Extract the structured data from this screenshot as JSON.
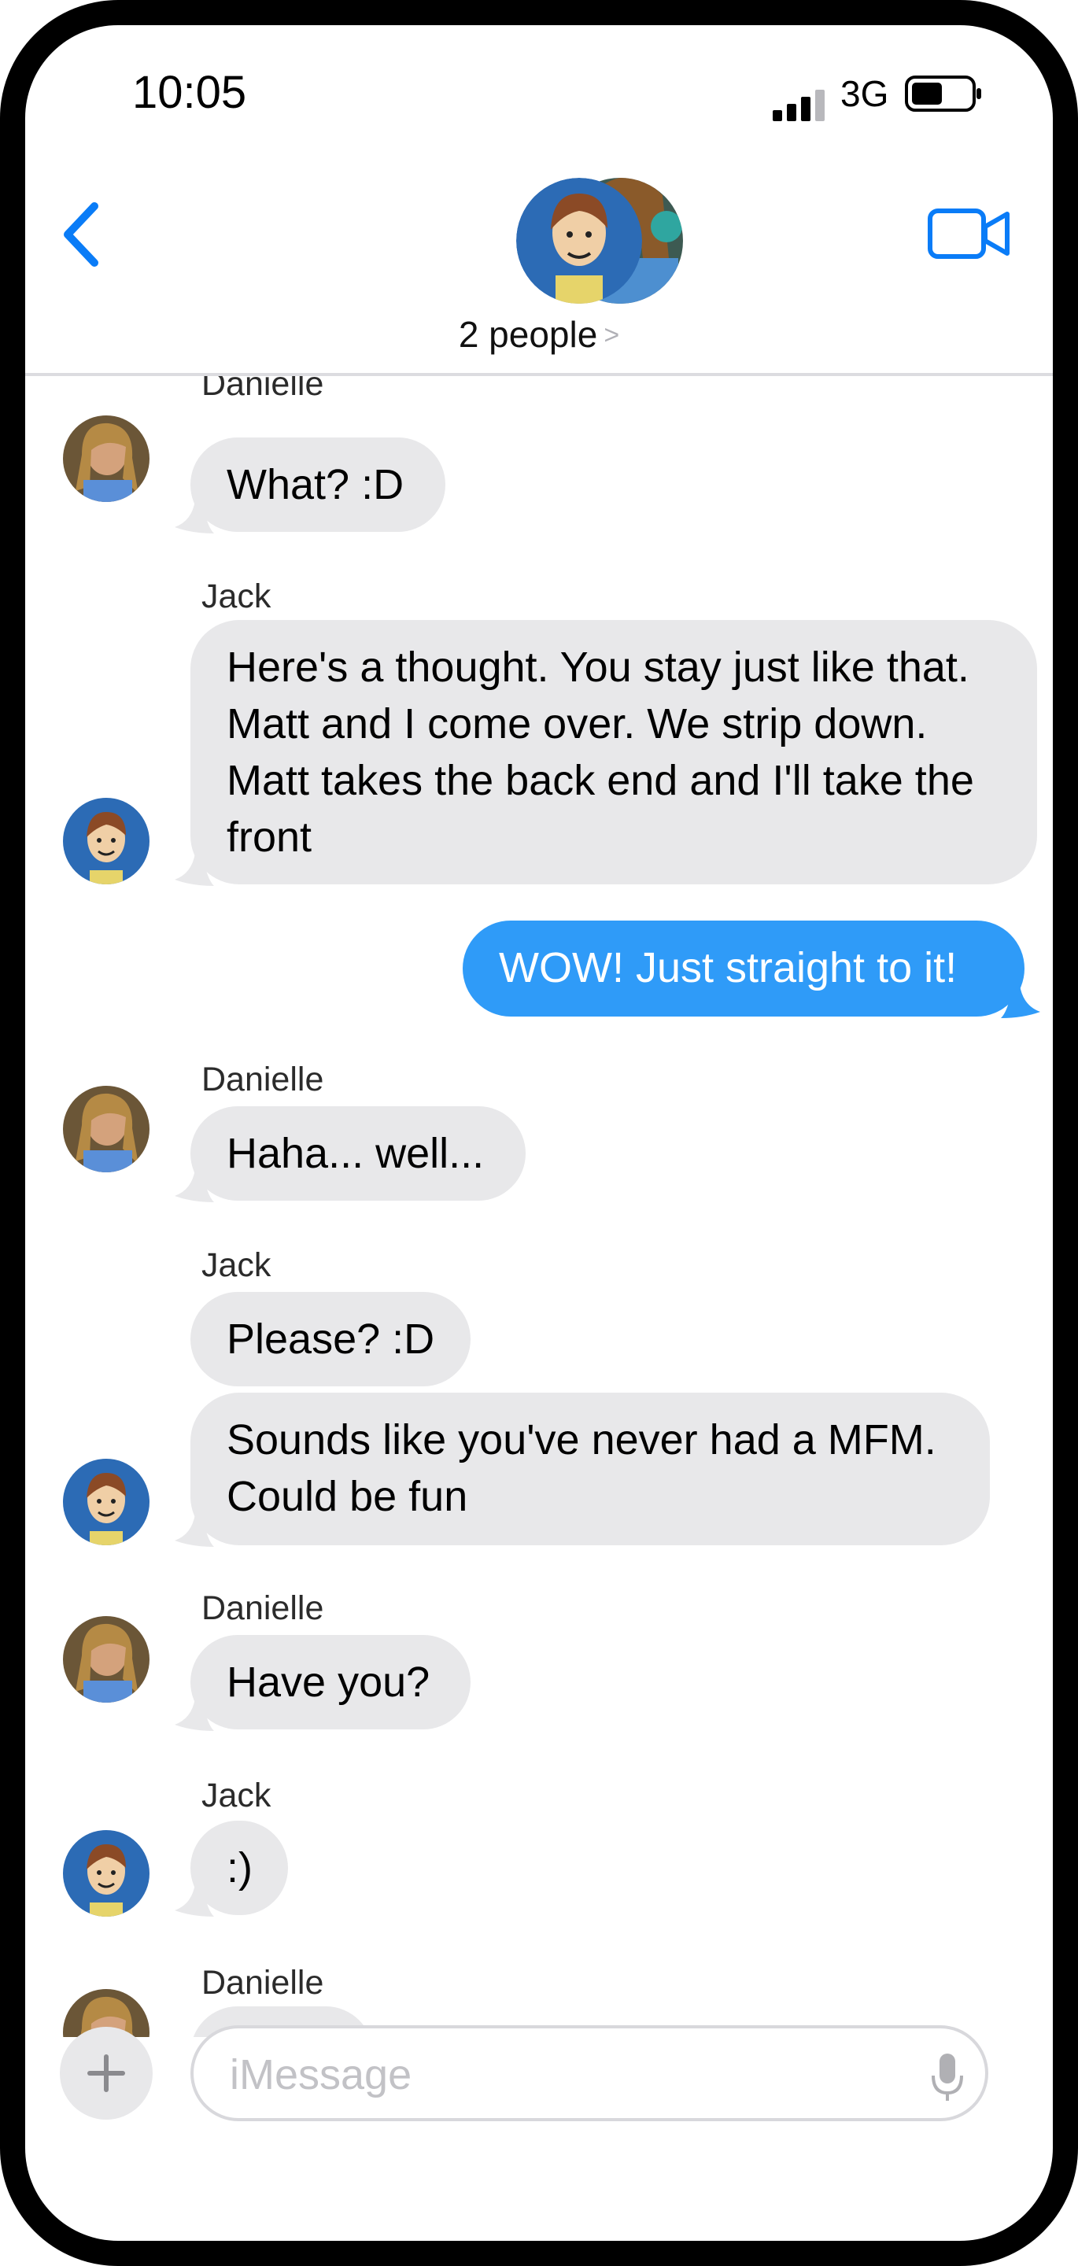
{
  "status_bar": {
    "time": "10:05",
    "network": "3G"
  },
  "header": {
    "participants_label": "2 people"
  },
  "messages": [
    {
      "sender": "Danielle",
      "text": "What? :D",
      "from_me": false
    },
    {
      "sender": "Jack",
      "text": "Here's a thought.  You stay just like that.\nMatt and I come over.  We strip down.\nMatt takes the back end and I'll take the\nfront",
      "from_me": false
    },
    {
      "sender": "",
      "text": "WOW!  Just straight to it!",
      "from_me": true
    },
    {
      "sender": "Danielle",
      "text": "Haha... well...",
      "from_me": false
    },
    {
      "sender": "Jack",
      "text": "Please? :D",
      "from_me": false
    },
    {
      "sender": "",
      "text": "Sounds like you've never had a MFM.\nCould be fun",
      "from_me": false
    },
    {
      "sender": "Danielle",
      "text": "Have you?",
      "from_me": false
    },
    {
      "sender": "Jack",
      "text": ":)",
      "from_me": false
    },
    {
      "sender": "Danielle",
      "text": "",
      "from_me": false
    }
  ],
  "input": {
    "placeholder": "iMessage"
  },
  "colors": {
    "accent": "#0a7cf7",
    "outgoing_bubble": "#2f9bf8",
    "incoming_bubble": "#e8e8ea"
  }
}
